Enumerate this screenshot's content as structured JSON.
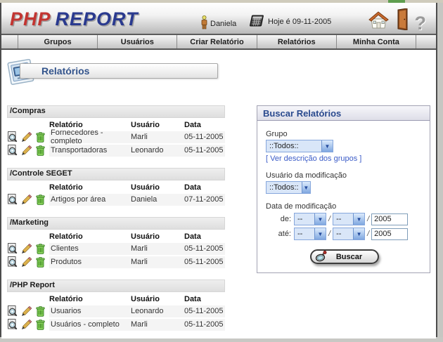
{
  "header": {
    "logo_php": "PHP",
    "logo_report": "REPORT",
    "user_name": "Daniela",
    "date_text": "Hoje é 09-11-2005"
  },
  "nav": {
    "items": [
      {
        "label": "Grupos"
      },
      {
        "label": "Usuários"
      },
      {
        "label": "Criar Relatório"
      },
      {
        "label": "Relatórios"
      },
      {
        "label": "Minha Conta"
      }
    ]
  },
  "page": {
    "title": "Relatórios"
  },
  "table_headers": {
    "report": "Relatório",
    "user": "Usuário",
    "date": "Data"
  },
  "groups": [
    {
      "name": "/Compras",
      "rows": [
        {
          "report": "Fornecedores - completo",
          "user": "Marli",
          "date": "05-11-2005"
        },
        {
          "report": "Transportadoras",
          "user": "Leonardo",
          "date": "05-11-2005"
        }
      ]
    },
    {
      "name": "/Controle SEGET",
      "rows": [
        {
          "report": "Artigos por área",
          "user": "Daniela",
          "date": "07-11-2005"
        }
      ]
    },
    {
      "name": "/Marketing",
      "rows": [
        {
          "report": "Clientes",
          "user": "Marli",
          "date": "05-11-2005"
        },
        {
          "report": "Produtos",
          "user": "Marli",
          "date": "05-11-2005"
        }
      ]
    },
    {
      "name": "/PHP Report",
      "rows": [
        {
          "report": "Usuarios",
          "user": "Leonardo",
          "date": "05-11-2005"
        },
        {
          "report": "Usuários - completo",
          "user": "Marli",
          "date": "05-11-2005"
        }
      ]
    }
  ],
  "search": {
    "title": "Buscar Relatórios",
    "group_label": "Grupo",
    "group_value": "::Todos::",
    "group_link": "[ Ver descrição dos grupos ]",
    "user_label": "Usuário da modificação",
    "user_value": "::Todos::",
    "date_label": "Data de modificação",
    "from_label": "de:",
    "to_label": "até:",
    "day_placeholder": "--",
    "month_placeholder": "--",
    "year_from": "2005",
    "year_to": "2005",
    "button_label": "Buscar"
  },
  "colors": {
    "logo_php": "#c23531",
    "logo_report": "#2a3a8f",
    "title_blue": "#33548c",
    "link_blue": "#3a5bc7",
    "row_bg": "#f4f4f4"
  }
}
